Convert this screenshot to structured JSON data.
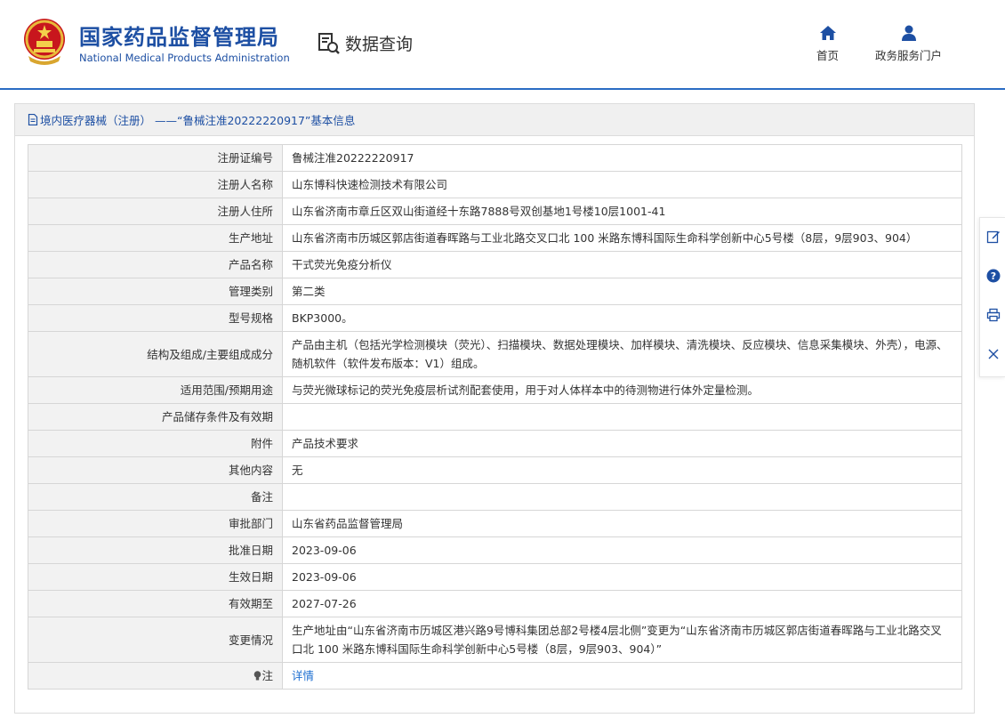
{
  "header": {
    "org_cn": "国家药品监督管理局",
    "org_en": "National Medical Products Administration",
    "data_query_label": "数据查询",
    "nav": [
      {
        "label": "首页",
        "icon": "home-icon"
      },
      {
        "label": "政务服务门户",
        "icon": "user-icon"
      }
    ]
  },
  "panel": {
    "title": "境内医疗器械（注册） ——“鲁械注准20222220917”基本信息"
  },
  "rows": [
    {
      "key": "注册证编号",
      "value": "鲁械注准20222220917"
    },
    {
      "key": "注册人名称",
      "value": "山东博科快速检测技术有限公司"
    },
    {
      "key": "注册人住所",
      "value": "山东省济南市章丘区双山街道经十东路7888号双创基地1号楼10层1001-41"
    },
    {
      "key": "生产地址",
      "value": "山东省济南市历城区郭店街道春晖路与工业北路交叉口北 100 米路东博科国际生命科学创新中心5号楼（8层，9层903、904）"
    },
    {
      "key": "产品名称",
      "value": "干式荧光免疫分析仪"
    },
    {
      "key": "管理类别",
      "value": "第二类"
    },
    {
      "key": "型号规格",
      "value": "BKP3000。"
    },
    {
      "key": "结构及组成/主要组成成分",
      "value": "产品由主机（包括光学检测模块（荧光）、扫描模块、数据处理模块、加样模块、清洗模块、反应模块、信息采集模块、外壳），电源、随机软件（软件发布版本：V1）组成。"
    },
    {
      "key": "适用范围/预期用途",
      "value": "与荧光微球标记的荧光免疫层析试剂配套使用，用于对人体样本中的待测物进行体外定量检测。"
    },
    {
      "key": "产品储存条件及有效期",
      "value": ""
    },
    {
      "key": "附件",
      "value": "产品技术要求"
    },
    {
      "key": "其他内容",
      "value": "无"
    },
    {
      "key": "备注",
      "value": ""
    },
    {
      "key": "审批部门",
      "value": "山东省药品监督管理局"
    },
    {
      "key": "批准日期",
      "value": "2023-09-06"
    },
    {
      "key": "生效日期",
      "value": "2023-09-06"
    },
    {
      "key": "有效期至",
      "value": "2027-07-26"
    },
    {
      "key": "变更情况",
      "value": "生产地址由“山东省济南市历城区港兴路9号博科集团总部2号楼4层北侧”变更为“山东省济南市历城区郭店街道春晖路与工业北路交叉口北 100 米路东博科国际生命科学创新中心5号楼（8层，9层903、904）”"
    }
  ],
  "note_row": {
    "key": "注",
    "value": "详情"
  },
  "sidebar": [
    "edit-icon",
    "help-icon",
    "print-icon",
    "close-icon"
  ],
  "colors": {
    "brand": "#1d4fa3",
    "link": "#1d6fd1",
    "key_bg": "#f2f2f2",
    "header_line": "#2a6cc4"
  }
}
